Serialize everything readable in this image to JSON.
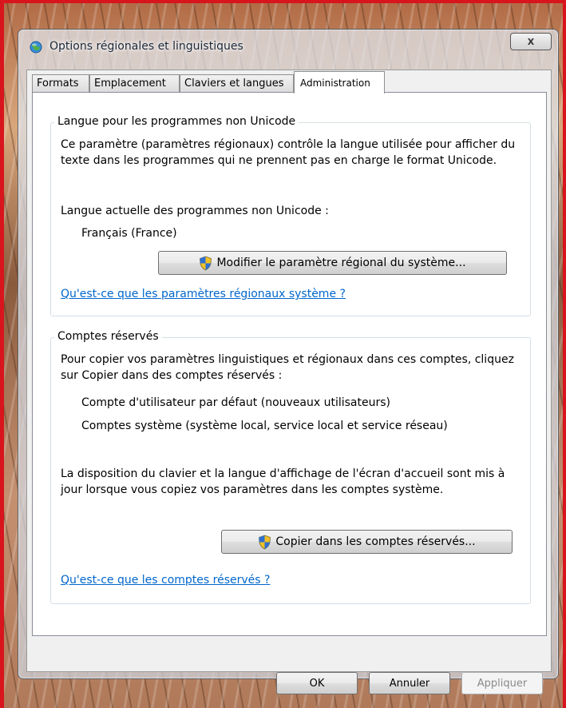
{
  "window": {
    "title": "Options régionales et linguistiques",
    "close_label": "X"
  },
  "tabs": [
    {
      "label": "Formats",
      "active": false
    },
    {
      "label": "Emplacement",
      "active": false
    },
    {
      "label": "Claviers et langues",
      "active": false
    },
    {
      "label": "Administration",
      "active": true
    }
  ],
  "unicode_group": {
    "legend": "Langue pour les programmes non Unicode",
    "description": "Ce paramètre (paramètres régionaux) contrôle la langue utilisée pour afficher du texte dans les programmes qui ne prennent pas en charge le format Unicode.",
    "current_label": "Langue actuelle des programmes non Unicode :",
    "current_value": "Français (France)",
    "change_button": "Modifier le paramètre régional du système...",
    "help_link": "Qu'est-ce que les paramètres régionaux système ?"
  },
  "reserved_group": {
    "legend": "Comptes réservés",
    "description": "Pour copier vos paramètres linguistiques et régionaux dans ces comptes, cliquez sur Copier dans des comptes réservés :",
    "accounts": [
      "Compte d'utilisateur par défaut (nouveaux utilisateurs)",
      "Comptes système (système local, service local et service réseau)"
    ],
    "note": "La disposition du clavier et la langue d'affichage de l'écran d'accueil sont mis à jour lorsque vous copiez vos paramètres dans les comptes système.",
    "copy_button": "Copier dans les comptes réservés...",
    "help_link": "Qu'est-ce que les comptes réservés ?"
  },
  "footer": {
    "ok": "OK",
    "cancel": "Annuler",
    "apply": "Appliquer"
  },
  "icons": {
    "app": "globe-icon",
    "close": "close-icon",
    "shield": "uac-shield-icon"
  }
}
